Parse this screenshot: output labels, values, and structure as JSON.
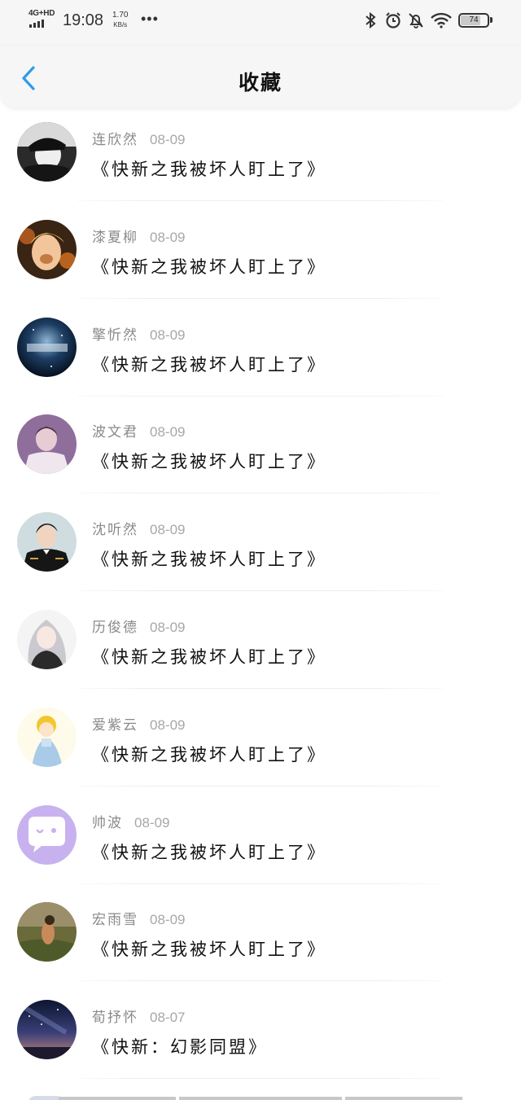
{
  "status_bar": {
    "network": "4G+HD",
    "time": "19:08",
    "speed_value": "1.70",
    "speed_unit": "KB/s",
    "more": "•••",
    "battery": "74"
  },
  "header": {
    "title": "收藏",
    "back_icon": "chevron-left-icon"
  },
  "favorites": [
    {
      "author": "连欣然",
      "date": "08-09",
      "title": "《快新之我被坏人盯上了》",
      "avatar": "avatar-bw-cap"
    },
    {
      "author": "漆夏柳",
      "date": "08-09",
      "title": "《快新之我被坏人盯上了》",
      "avatar": "avatar-blonde-child"
    },
    {
      "author": "擎忻然",
      "date": "08-09",
      "title": "《快新之我被坏人盯上了》",
      "avatar": "avatar-galaxy-text"
    },
    {
      "author": "波文君",
      "date": "08-09",
      "title": "《快新之我被坏人盯上了》",
      "avatar": "avatar-purple-person"
    },
    {
      "author": "沈听然",
      "date": "08-09",
      "title": "《快新之我被坏人盯上了》",
      "avatar": "avatar-man-uniform"
    },
    {
      "author": "历俊德",
      "date": "08-09",
      "title": "《快新之我被坏人盯上了》",
      "avatar": "avatar-anime-girl"
    },
    {
      "author": "爱紫云",
      "date": "08-09",
      "title": "《快新之我被坏人盯上了》",
      "avatar": "avatar-cartoon-princess"
    },
    {
      "author": "帅波",
      "date": "08-09",
      "title": "《快新之我被坏人盯上了》",
      "avatar": "avatar-chat-bubble"
    },
    {
      "author": "宏雨雪",
      "date": "08-09",
      "title": "《快新之我被坏人盯上了》",
      "avatar": "avatar-nature-person"
    },
    {
      "author": "荀抒怀",
      "date": "08-07",
      "title": "《快新：幻影同盟》",
      "avatar": "avatar-night-sky"
    }
  ],
  "colors": {
    "accent": "#2f9bea",
    "author_text": "#8a8a8a",
    "date_text": "#a7a7a7",
    "title_text": "#111111",
    "header_bg": "#f6f6f6"
  }
}
